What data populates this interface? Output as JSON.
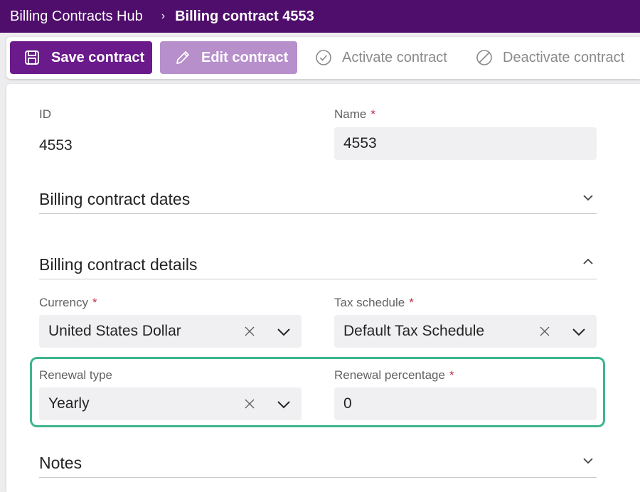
{
  "header": {
    "app_title": "Billing Contracts Hub",
    "separator": "›",
    "current_page": "Billing contract 4553"
  },
  "toolbar": {
    "save_label": "Save contract",
    "edit_label": "Edit contract",
    "activate_label": "Activate contract",
    "deactivate_label": "Deactivate contract"
  },
  "form": {
    "id": {
      "label": "ID",
      "value": "4553"
    },
    "name": {
      "label": "Name",
      "required": "*",
      "value": "4553"
    },
    "sections": {
      "dates": {
        "title": "Billing contract dates",
        "state": "collapsed"
      },
      "details": {
        "title": "Billing contract details",
        "state": "expanded"
      },
      "notes": {
        "title": "Notes",
        "state": "collapsed"
      }
    },
    "currency": {
      "label": "Currency",
      "required": "*",
      "value": "United States Dollar"
    },
    "tax_schedule": {
      "label": "Tax schedule",
      "required": "*",
      "value": "Default Tax Schedule"
    },
    "renewal_type": {
      "label": "Renewal type",
      "value": "Yearly"
    },
    "renewal_percentage": {
      "label": "Renewal percentage",
      "required": "*",
      "value": "0"
    }
  },
  "colors": {
    "header_bg": "#4f0e6b",
    "primary_button": "#6a1a8a",
    "disabled_button": "#b68fcb",
    "required_marker": "#c4314b",
    "highlight_border": "#3fb58e"
  },
  "icons": {
    "save": "save-icon",
    "edit": "pencil-icon",
    "activate": "check-circle-icon",
    "deactivate": "prohibited-icon",
    "clear": "close-icon",
    "dropdown": "chevron-down-icon",
    "collapse": "chevron-up-icon"
  }
}
